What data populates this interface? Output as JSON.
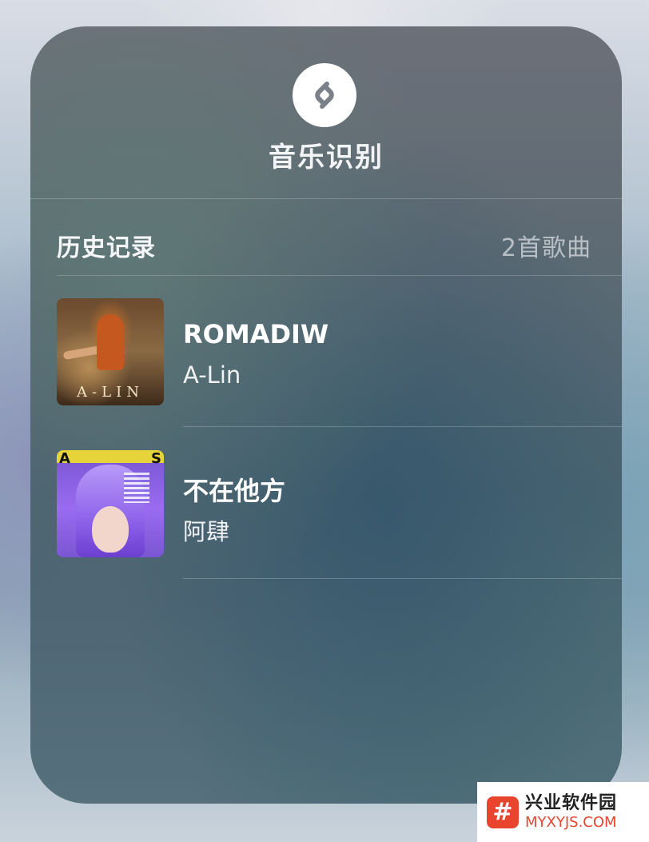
{
  "widget": {
    "app_icon": "shazam-logo-icon",
    "title": "音乐识别"
  },
  "history": {
    "title": "历史记录",
    "count": "2首歌曲",
    "songs": [
      {
        "title": "ROMADIW",
        "artist": "A-Lin",
        "cover_icon": "album-cover"
      },
      {
        "title": "不在他方",
        "artist": "阿肆",
        "cover_icon": "album-cover"
      }
    ]
  },
  "watermark": {
    "logo": "#",
    "name": "兴业软件园",
    "url": "MYXYJS.COM"
  }
}
